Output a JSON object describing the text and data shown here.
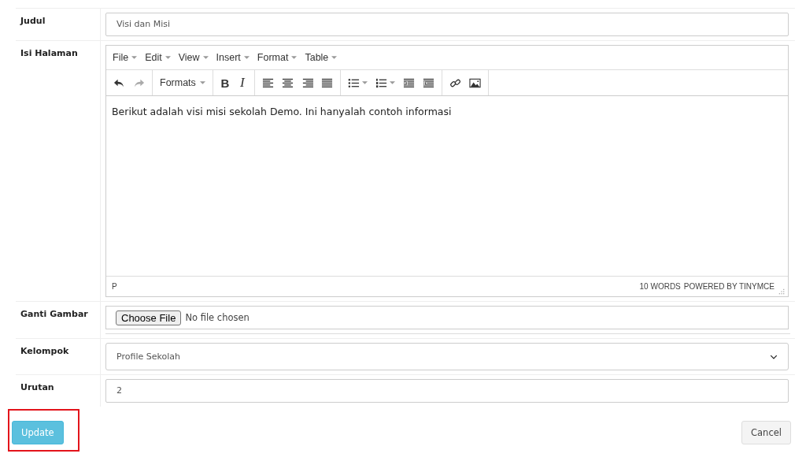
{
  "form": {
    "rows": [
      {
        "kind": "text",
        "label": "Judul",
        "value": "Visi dan Misi"
      },
      {
        "kind": "editor",
        "label": "Isi Halaman"
      },
      {
        "kind": "file",
        "label": "Ganti Gambar",
        "button": "Choose File",
        "status": "No file chosen"
      },
      {
        "kind": "select",
        "label": "Kelompok",
        "value": "Profile Sekolah"
      },
      {
        "kind": "text",
        "label": "Urutan",
        "value": "2"
      }
    ]
  },
  "editor": {
    "menus": [
      "File",
      "Edit",
      "View",
      "Insert",
      "Format",
      "Table"
    ],
    "toolbar": [
      [
        {
          "kind": "undo",
          "disabled": false
        },
        {
          "kind": "redo",
          "disabled": true
        }
      ],
      [
        {
          "kind": "dropdown",
          "label": "Formats"
        }
      ],
      [
        {
          "kind": "bold",
          "label": "B"
        },
        {
          "kind": "italic",
          "label": "I"
        }
      ],
      [
        {
          "kind": "align-left"
        },
        {
          "kind": "align-center"
        },
        {
          "kind": "align-right"
        },
        {
          "kind": "align-justify"
        }
      ],
      [
        {
          "kind": "bullets"
        },
        {
          "kind": "numbers"
        },
        {
          "kind": "outdent"
        },
        {
          "kind": "indent"
        }
      ],
      [
        {
          "kind": "link"
        },
        {
          "kind": "image"
        }
      ]
    ],
    "content": "Berikut adalah visi misi sekolah Demo. Ini hanyalah contoh informasi",
    "path": "P",
    "word_count": "10 WORDS",
    "powered_by": "POWERED BY TINYMCE"
  },
  "actions": [
    {
      "label": "Update",
      "kind": "primary",
      "highlighted": true
    },
    {
      "label": "Cancel",
      "kind": "default",
      "highlighted": false
    }
  ]
}
